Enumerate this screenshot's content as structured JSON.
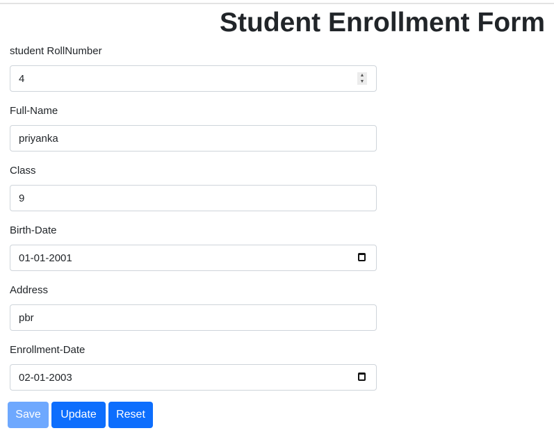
{
  "title": "Student Enrollment Form",
  "fields": [
    {
      "label": "student RollNumber",
      "value": "4",
      "type": "number"
    },
    {
      "label": "Full-Name",
      "value": "priyanka",
      "type": "text"
    },
    {
      "label": "Class",
      "value": "9",
      "type": "text"
    },
    {
      "label": "Birth-Date",
      "value": "01-01-2001",
      "type": "date"
    },
    {
      "label": "Address",
      "value": "pbr",
      "type": "text"
    },
    {
      "label": "Enrollment-Date",
      "value": "02-01-2003",
      "type": "date"
    }
  ],
  "buttons": {
    "save": "Save",
    "update": "Update",
    "reset": "Reset"
  },
  "colors": {
    "primary": "#0d6efd",
    "disabled": "#6ea8fe"
  },
  "icons": {
    "spinner": "number-spinner-icon",
    "calendar": "calendar-icon"
  }
}
